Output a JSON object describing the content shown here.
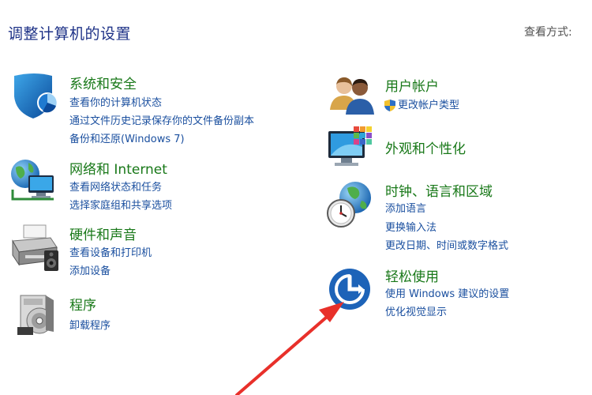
{
  "header": {
    "title": "调整计算机的设置",
    "view_by_label": "查看方式:"
  },
  "categories": {
    "system_security": {
      "title": "系统和安全",
      "icon": "security-shield-icon",
      "links": [
        "查看你的计算机状态",
        "通过文件历史记录保存你的文件备份副本",
        "备份和还原(Windows 7)"
      ]
    },
    "network": {
      "title": "网络和 Internet",
      "icon": "network-globe-icon",
      "links": [
        "查看网络状态和任务",
        "选择家庭组和共享选项"
      ]
    },
    "hardware": {
      "title": "硬件和声音",
      "icon": "printer-speaker-icon",
      "links": [
        "查看设备和打印机",
        "添加设备"
      ]
    },
    "programs": {
      "title": "程序",
      "icon": "programs-disc-icon",
      "links": [
        "卸载程序"
      ]
    },
    "user_accounts": {
      "title": "用户帐户",
      "icon": "users-icon",
      "links": [
        "更改帐户类型"
      ]
    },
    "appearance": {
      "title": "外观和个性化",
      "icon": "monitor-palette-icon",
      "links": []
    },
    "clock_region": {
      "title": "时钟、语言和区域",
      "icon": "clock-globe-icon",
      "links": [
        "添加语言",
        "更换输入法",
        "更改日期、时间或数字格式"
      ]
    },
    "ease_of_access": {
      "title": "轻松使用",
      "icon": "ease-of-access-icon",
      "links": [
        "使用 Windows 建议的设置",
        "优化视觉显示"
      ]
    }
  },
  "colors": {
    "title_blue": "#1e3287",
    "category_green": "#187818",
    "link_blue": "#1a4f9f",
    "annotation_red": "#e8302a"
  }
}
